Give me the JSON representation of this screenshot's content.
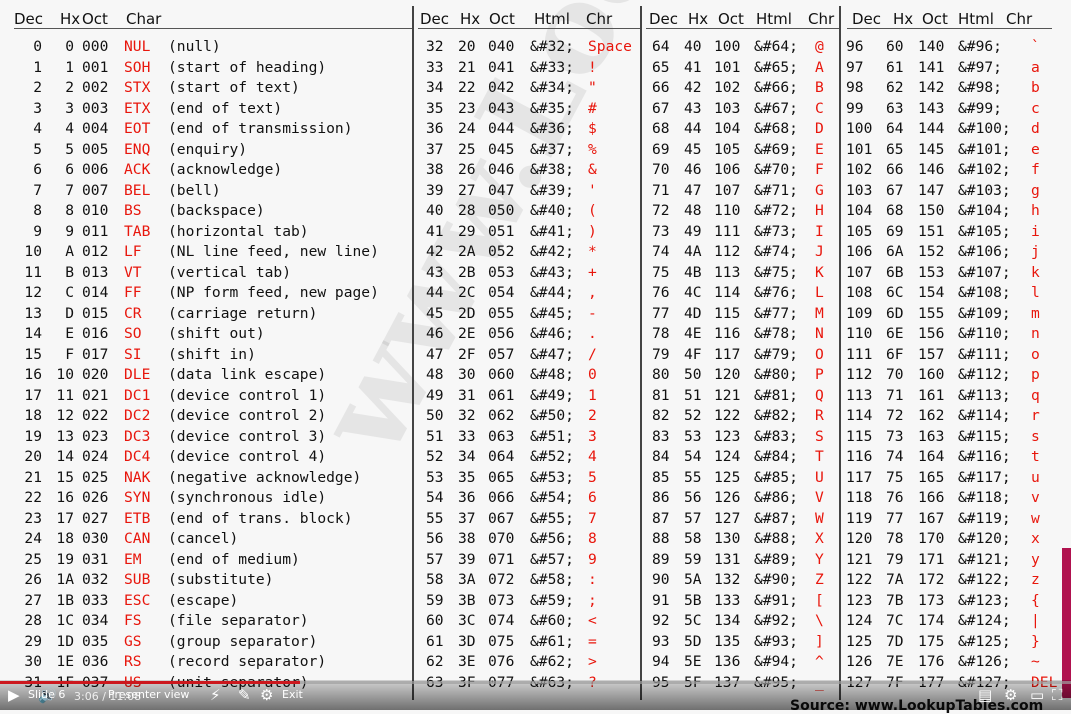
{
  "headers": {
    "col1": [
      "Dec",
      "Hx",
      "Oct",
      "Char"
    ],
    "col2": [
      "Dec",
      "Hx",
      "Oct",
      "Html",
      "Chr"
    ],
    "col3": [
      "Dec",
      "Hx",
      "Oct",
      "Html",
      "Chr"
    ],
    "col4": [
      "Dec",
      "Hx",
      "Oct",
      "Html",
      "Chr"
    ]
  },
  "control_rows": [
    [
      "0",
      "0",
      "000",
      "NUL",
      "(null)"
    ],
    [
      "1",
      "1",
      "001",
      "SOH",
      "(start of heading)"
    ],
    [
      "2",
      "2",
      "002",
      "STX",
      "(start of text)"
    ],
    [
      "3",
      "3",
      "003",
      "ETX",
      "(end of text)"
    ],
    [
      "4",
      "4",
      "004",
      "EOT",
      "(end of transmission)"
    ],
    [
      "5",
      "5",
      "005",
      "ENQ",
      "(enquiry)"
    ],
    [
      "6",
      "6",
      "006",
      "ACK",
      "(acknowledge)"
    ],
    [
      "7",
      "7",
      "007",
      "BEL",
      "(bell)"
    ],
    [
      "8",
      "8",
      "010",
      "BS",
      "(backspace)"
    ],
    [
      "9",
      "9",
      "011",
      "TAB",
      "(horizontal tab)"
    ],
    [
      "10",
      "A",
      "012",
      "LF",
      "(NL line feed, new line)"
    ],
    [
      "11",
      "B",
      "013",
      "VT",
      "(vertical tab)"
    ],
    [
      "12",
      "C",
      "014",
      "FF",
      "(NP form feed, new page)"
    ],
    [
      "13",
      "D",
      "015",
      "CR",
      "(carriage return)"
    ],
    [
      "14",
      "E",
      "016",
      "SO",
      "(shift out)"
    ],
    [
      "15",
      "F",
      "017",
      "SI",
      "(shift in)"
    ],
    [
      "16",
      "10",
      "020",
      "DLE",
      "(data link escape)"
    ],
    [
      "17",
      "11",
      "021",
      "DC1",
      "(device control 1)"
    ],
    [
      "18",
      "12",
      "022",
      "DC2",
      "(device control 2)"
    ],
    [
      "19",
      "13",
      "023",
      "DC3",
      "(device control 3)"
    ],
    [
      "20",
      "14",
      "024",
      "DC4",
      "(device control 4)"
    ],
    [
      "21",
      "15",
      "025",
      "NAK",
      "(negative acknowledge)"
    ],
    [
      "22",
      "16",
      "026",
      "SYN",
      "(synchronous idle)"
    ],
    [
      "23",
      "17",
      "027",
      "ETB",
      "(end of trans. block)"
    ],
    [
      "24",
      "18",
      "030",
      "CAN",
      "(cancel)"
    ],
    [
      "25",
      "19",
      "031",
      "EM",
      "(end of medium)"
    ],
    [
      "26",
      "1A",
      "032",
      "SUB",
      "(substitute)"
    ],
    [
      "27",
      "1B",
      "033",
      "ESC",
      "(escape)"
    ],
    [
      "28",
      "1C",
      "034",
      "FS",
      "(file separator)"
    ],
    [
      "29",
      "1D",
      "035",
      "GS",
      "(group separator)"
    ],
    [
      "30",
      "1E",
      "036",
      "RS",
      "(record separator)"
    ],
    [
      "31",
      "1F",
      "037",
      "US",
      "(unit separator)"
    ]
  ],
  "printable_cols": [
    [
      [
        "32",
        "20",
        "040",
        "&#32;",
        "Space"
      ],
      [
        "33",
        "21",
        "041",
        "&#33;",
        "!"
      ],
      [
        "34",
        "22",
        "042",
        "&#34;",
        "\""
      ],
      [
        "35",
        "23",
        "043",
        "&#35;",
        "#"
      ],
      [
        "36",
        "24",
        "044",
        "&#36;",
        "$"
      ],
      [
        "37",
        "25",
        "045",
        "&#37;",
        "%"
      ],
      [
        "38",
        "26",
        "046",
        "&#38;",
        "&"
      ],
      [
        "39",
        "27",
        "047",
        "&#39;",
        "'"
      ],
      [
        "40",
        "28",
        "050",
        "&#40;",
        "("
      ],
      [
        "41",
        "29",
        "051",
        "&#41;",
        ")"
      ],
      [
        "42",
        "2A",
        "052",
        "&#42;",
        "*"
      ],
      [
        "43",
        "2B",
        "053",
        "&#43;",
        "+"
      ],
      [
        "44",
        "2C",
        "054",
        "&#44;",
        ","
      ],
      [
        "45",
        "2D",
        "055",
        "&#45;",
        "-"
      ],
      [
        "46",
        "2E",
        "056",
        "&#46;",
        "."
      ],
      [
        "47",
        "2F",
        "057",
        "&#47;",
        "/"
      ],
      [
        "48",
        "30",
        "060",
        "&#48;",
        "0"
      ],
      [
        "49",
        "31",
        "061",
        "&#49;",
        "1"
      ],
      [
        "50",
        "32",
        "062",
        "&#50;",
        "2"
      ],
      [
        "51",
        "33",
        "063",
        "&#51;",
        "3"
      ],
      [
        "52",
        "34",
        "064",
        "&#52;",
        "4"
      ],
      [
        "53",
        "35",
        "065",
        "&#53;",
        "5"
      ],
      [
        "54",
        "36",
        "066",
        "&#54;",
        "6"
      ],
      [
        "55",
        "37",
        "067",
        "&#55;",
        "7"
      ],
      [
        "56",
        "38",
        "070",
        "&#56;",
        "8"
      ],
      [
        "57",
        "39",
        "071",
        "&#57;",
        "9"
      ],
      [
        "58",
        "3A",
        "072",
        "&#58;",
        ":"
      ],
      [
        "59",
        "3B",
        "073",
        "&#59;",
        ";"
      ],
      [
        "60",
        "3C",
        "074",
        "&#60;",
        "<"
      ],
      [
        "61",
        "3D",
        "075",
        "&#61;",
        "="
      ],
      [
        "62",
        "3E",
        "076",
        "&#62;",
        ">"
      ],
      [
        "63",
        "3F",
        "077",
        "&#63;",
        "?"
      ]
    ],
    [
      [
        "64",
        "40",
        "100",
        "&#64;",
        "@"
      ],
      [
        "65",
        "41",
        "101",
        "&#65;",
        "A"
      ],
      [
        "66",
        "42",
        "102",
        "&#66;",
        "B"
      ],
      [
        "67",
        "43",
        "103",
        "&#67;",
        "C"
      ],
      [
        "68",
        "44",
        "104",
        "&#68;",
        "D"
      ],
      [
        "69",
        "45",
        "105",
        "&#69;",
        "E"
      ],
      [
        "70",
        "46",
        "106",
        "&#70;",
        "F"
      ],
      [
        "71",
        "47",
        "107",
        "&#71;",
        "G"
      ],
      [
        "72",
        "48",
        "110",
        "&#72;",
        "H"
      ],
      [
        "73",
        "49",
        "111",
        "&#73;",
        "I"
      ],
      [
        "74",
        "4A",
        "112",
        "&#74;",
        "J"
      ],
      [
        "75",
        "4B",
        "113",
        "&#75;",
        "K"
      ],
      [
        "76",
        "4C",
        "114",
        "&#76;",
        "L"
      ],
      [
        "77",
        "4D",
        "115",
        "&#77;",
        "M"
      ],
      [
        "78",
        "4E",
        "116",
        "&#78;",
        "N"
      ],
      [
        "79",
        "4F",
        "117",
        "&#79;",
        "O"
      ],
      [
        "80",
        "50",
        "120",
        "&#80;",
        "P"
      ],
      [
        "81",
        "51",
        "121",
        "&#81;",
        "Q"
      ],
      [
        "82",
        "52",
        "122",
        "&#82;",
        "R"
      ],
      [
        "83",
        "53",
        "123",
        "&#83;",
        "S"
      ],
      [
        "84",
        "54",
        "124",
        "&#84;",
        "T"
      ],
      [
        "85",
        "55",
        "125",
        "&#85;",
        "U"
      ],
      [
        "86",
        "56",
        "126",
        "&#86;",
        "V"
      ],
      [
        "87",
        "57",
        "127",
        "&#87;",
        "W"
      ],
      [
        "88",
        "58",
        "130",
        "&#88;",
        "X"
      ],
      [
        "89",
        "59",
        "131",
        "&#89;",
        "Y"
      ],
      [
        "90",
        "5A",
        "132",
        "&#90;",
        "Z"
      ],
      [
        "91",
        "5B",
        "133",
        "&#91;",
        "["
      ],
      [
        "92",
        "5C",
        "134",
        "&#92;",
        "\\"
      ],
      [
        "93",
        "5D",
        "135",
        "&#93;",
        "]"
      ],
      [
        "94",
        "5E",
        "136",
        "&#94;",
        "^"
      ],
      [
        "95",
        "5F",
        "137",
        "&#95;",
        "_"
      ]
    ],
    [
      [
        "96",
        "60",
        "140",
        "&#96;",
        "`"
      ],
      [
        "97",
        "61",
        "141",
        "&#97;",
        "a"
      ],
      [
        "98",
        "62",
        "142",
        "&#98;",
        "b"
      ],
      [
        "99",
        "63",
        "143",
        "&#99;",
        "c"
      ],
      [
        "100",
        "64",
        "144",
        "&#100;",
        "d"
      ],
      [
        "101",
        "65",
        "145",
        "&#101;",
        "e"
      ],
      [
        "102",
        "66",
        "146",
        "&#102;",
        "f"
      ],
      [
        "103",
        "67",
        "147",
        "&#103;",
        "g"
      ],
      [
        "104",
        "68",
        "150",
        "&#104;",
        "h"
      ],
      [
        "105",
        "69",
        "151",
        "&#105;",
        "i"
      ],
      [
        "106",
        "6A",
        "152",
        "&#106;",
        "j"
      ],
      [
        "107",
        "6B",
        "153",
        "&#107;",
        "k"
      ],
      [
        "108",
        "6C",
        "154",
        "&#108;",
        "l"
      ],
      [
        "109",
        "6D",
        "155",
        "&#109;",
        "m"
      ],
      [
        "110",
        "6E",
        "156",
        "&#110;",
        "n"
      ],
      [
        "111",
        "6F",
        "157",
        "&#111;",
        "o"
      ],
      [
        "112",
        "70",
        "160",
        "&#112;",
        "p"
      ],
      [
        "113",
        "71",
        "161",
        "&#113;",
        "q"
      ],
      [
        "114",
        "72",
        "162",
        "&#114;",
        "r"
      ],
      [
        "115",
        "73",
        "163",
        "&#115;",
        "s"
      ],
      [
        "116",
        "74",
        "164",
        "&#116;",
        "t"
      ],
      [
        "117",
        "75",
        "165",
        "&#117;",
        "u"
      ],
      [
        "118",
        "76",
        "166",
        "&#118;",
        "v"
      ],
      [
        "119",
        "77",
        "167",
        "&#119;",
        "w"
      ],
      [
        "120",
        "78",
        "170",
        "&#120;",
        "x"
      ],
      [
        "121",
        "79",
        "171",
        "&#121;",
        "y"
      ],
      [
        "122",
        "7A",
        "172",
        "&#122;",
        "z"
      ],
      [
        "123",
        "7B",
        "173",
        "&#123;",
        "{"
      ],
      [
        "124",
        "7C",
        "174",
        "&#124;",
        "|"
      ],
      [
        "125",
        "7D",
        "175",
        "&#125;",
        "}"
      ],
      [
        "126",
        "7E",
        "176",
        "&#126;",
        "~"
      ],
      [
        "127",
        "7F",
        "177",
        "&#127;",
        "DEL"
      ]
    ]
  ],
  "watermark": "www.LookupTables.com",
  "source_text": "Source: www.LookupTables.com",
  "player": {
    "play_icon": "play-icon",
    "volume_icon": "volume-icon",
    "slide_label": "Slide 6",
    "presenter_label": "Presenter view",
    "exit_label": "Exit",
    "time_current": "3:06",
    "time_total": "11:08",
    "progress": 0.28,
    "accent_color": "#cc181e"
  },
  "colors": {
    "symbol_red": "#e8160c"
  }
}
